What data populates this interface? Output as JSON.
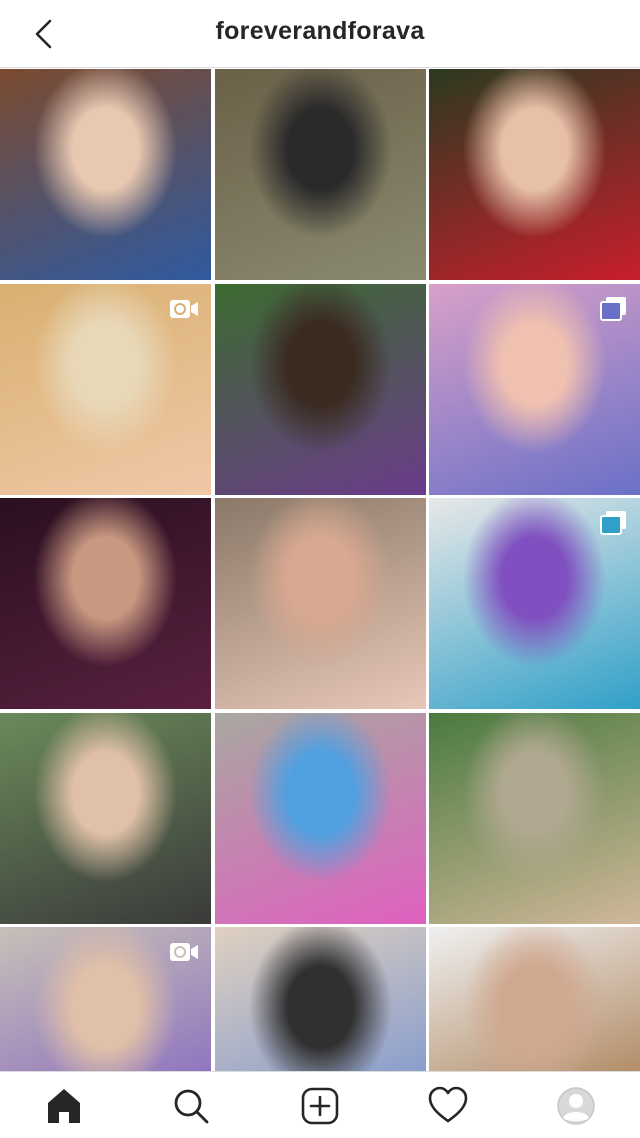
{
  "header": {
    "username": "foreverandforava"
  },
  "grid": {
    "posts": [
      {
        "kind": "photo",
        "colors": [
          "#7b4a2f",
          "#2f5aa0",
          "#e8c8b0"
        ]
      },
      {
        "kind": "photo",
        "colors": [
          "#6b6048",
          "#8a8a70",
          "#2a2a2a"
        ]
      },
      {
        "kind": "photo",
        "colors": [
          "#2b3a20",
          "#c81e2c",
          "#e8c0a8"
        ]
      },
      {
        "kind": "video",
        "colors": [
          "#d9b070",
          "#f0c8a8",
          "#e8d8b8"
        ]
      },
      {
        "kind": "photo",
        "colors": [
          "#3c6a30",
          "#6a3c8a",
          "#3a2a20"
        ]
      },
      {
        "kind": "carousel",
        "colors": [
          "#d8a0c8",
          "#6a70c8",
          "#f0c0b0"
        ]
      },
      {
        "kind": "photo",
        "colors": [
          "#2a1020",
          "#5a2040",
          "#c89880"
        ]
      },
      {
        "kind": "photo",
        "colors": [
          "#8a7868",
          "#e8c8b8",
          "#d8a890"
        ]
      },
      {
        "kind": "carousel",
        "colors": [
          "#e8e8e8",
          "#30a0c8",
          "#8050c0"
        ]
      },
      {
        "kind": "photo",
        "colors": [
          "#6a8a5a",
          "#3a3a3a",
          "#e0c0a8"
        ]
      },
      {
        "kind": "photo",
        "colors": [
          "#a8a8a0",
          "#e060c0",
          "#50a0e0"
        ]
      },
      {
        "kind": "photo",
        "colors": [
          "#4a7a40",
          "#d0b898",
          "#b0a890"
        ]
      },
      {
        "kind": "video",
        "colors": [
          "#c8c0b8",
          "#8060c0",
          "#e0c0a8"
        ]
      },
      {
        "kind": "photo",
        "colors": [
          "#e0d0c0",
          "#7090d0",
          "#303030"
        ]
      },
      {
        "kind": "photo",
        "colors": [
          "#f0f0f0",
          "#a07040",
          "#d0a890"
        ]
      }
    ]
  },
  "tabbar": {
    "items": [
      "home-icon",
      "search-icon",
      "new-post-icon",
      "activity-icon",
      "profile-icon"
    ]
  },
  "colors": {
    "text": "#262626",
    "divider": "#dbdbdb",
    "background": "#ffffff"
  }
}
